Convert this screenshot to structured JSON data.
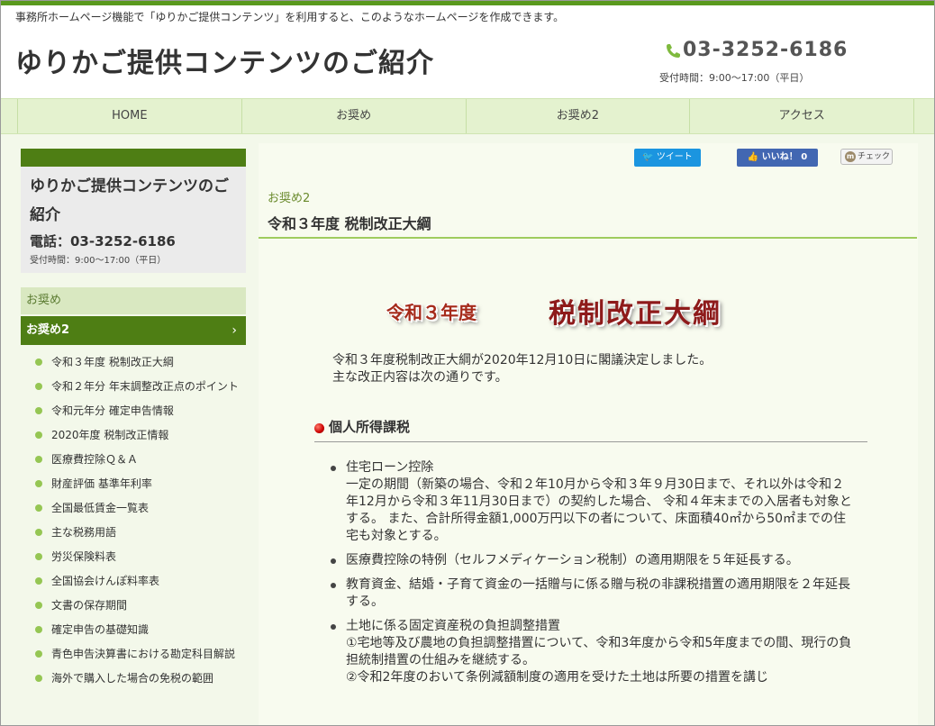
{
  "header": {
    "tagline": "事務所ホームページ機能で「ゆりかご提供コンテンツ」を利用すると、このようなホームページを作成できます。",
    "site_title": "ゆりかご提供コンテンツのご紹介",
    "phone": "03-3252-6186",
    "hours": "受付時間：9:00～17:00（平日）"
  },
  "nav": {
    "items": [
      {
        "label": "HOME"
      },
      {
        "label": "お奨め"
      },
      {
        "label": "お奨め2"
      },
      {
        "label": "アクセス"
      }
    ]
  },
  "sidebar": {
    "title": "ゆりかご提供コンテンツのご紹介",
    "tel": "電話：03-3252-6186",
    "hours": "受付時間：9:00～17:00（平日）",
    "category": "お奨め",
    "active": "お奨め2",
    "items": [
      {
        "label": "令和３年度 税制改正大綱"
      },
      {
        "label": "令和２年分 年末調整改正点のポイント"
      },
      {
        "label": "令和元年分 確定申告情報"
      },
      {
        "label": "2020年度 税制改正情報"
      },
      {
        "label": "医療費控除Ｑ＆Ａ"
      },
      {
        "label": "財産評価 基準年利率"
      },
      {
        "label": "全国最低賃金一覧表"
      },
      {
        "label": "主な税務用語"
      },
      {
        "label": "労災保険料表"
      },
      {
        "label": "全国協会けんぽ料率表"
      },
      {
        "label": "文書の保存期間"
      },
      {
        "label": "確定申告の基礎知識"
      },
      {
        "label": "青色申告決算書における勘定科目解説"
      },
      {
        "label": "海外で購入した場合の免税の範囲"
      }
    ]
  },
  "social": {
    "tweet": "ツイート",
    "like": "いいね！ 0",
    "check": "チェック",
    "check_icon_letter": "m"
  },
  "main": {
    "breadcrumb": "お奨め2",
    "heading": "令和３年度 税制改正大綱",
    "banner_year": "令和３年度",
    "banner_title": "税制改正大綱",
    "intro_line1": "令和３年度税制改正大綱が2020年12月10日に閣議決定しました。",
    "intro_line2": "主な改正内容は次の通りです。",
    "section_title": "個人所得課税",
    "bullets": [
      {
        "title": "住宅ローン控除",
        "body": "一定の期間（新築の場合、令和２年10月から令和３年９月30日まで、それ以外は令和２年12月から令和３年11月30日まで）の契約した場合、 令和４年末までの入居者も対象とする。 また、合計所得金額1,000万円以下の者について、床面積40㎡から50㎡までの住宅も対象とする。"
      },
      {
        "title": "医療費控除の特例（セルフメディケーション税制）の適用期限を５年延長する。",
        "body": ""
      },
      {
        "title": "教育資金、結婚・子育て資金の一括贈与に係る贈与税の非課税措置の適用期限を２年延長する。",
        "body": ""
      },
      {
        "title": "土地に係る固定資産税の負担調整措置",
        "body": "①宅地等及び農地の負担調整措置について、令和3年度から令和5年度までの間、現行の負担統制措置の仕組みを継続する。",
        "body2": "②令和2年度のおいて条例減額制度の適用を受けた土地は所要の措置を講じ"
      }
    ]
  }
}
